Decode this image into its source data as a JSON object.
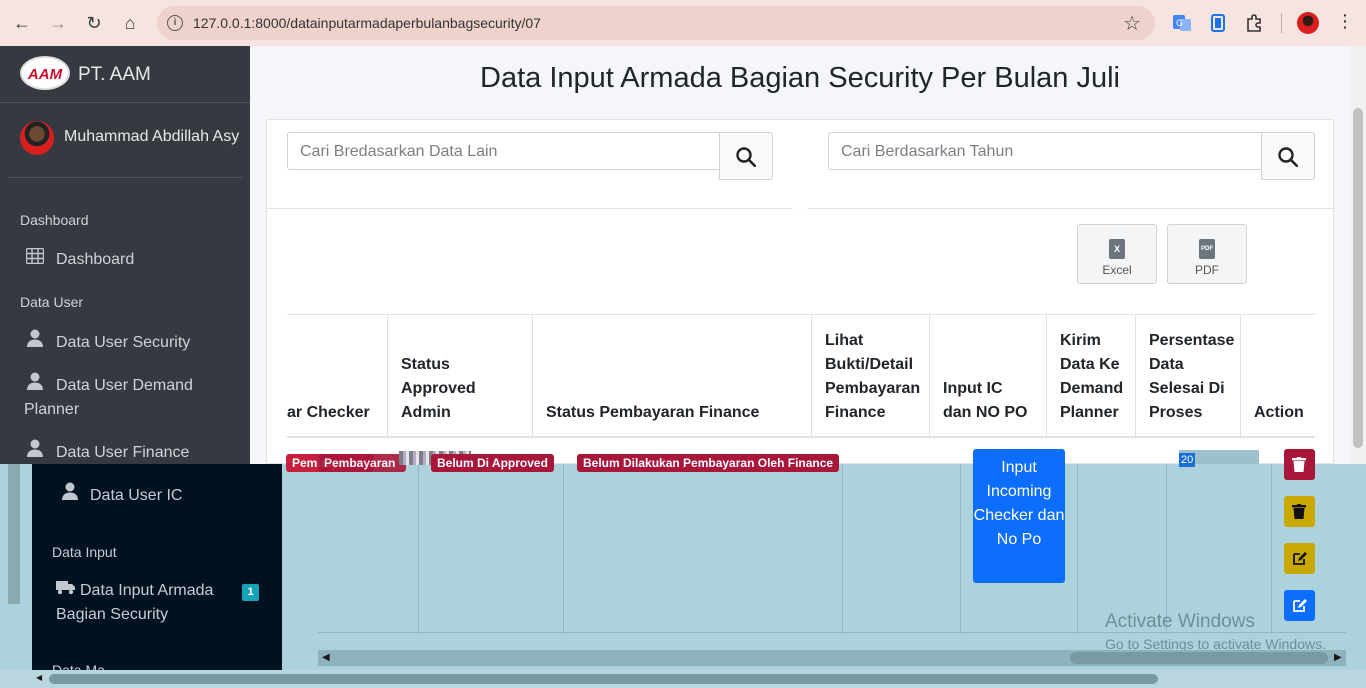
{
  "browser": {
    "url": "127.0.0.1:8000/datainputarmadaperbulanbagsecurity/07"
  },
  "sidebar": {
    "brand_logo": "AAM",
    "brand_text": "PT. AAM",
    "user_name": "Muhammad Abdillah Asy",
    "sections": [
      {
        "header": "Dashboard"
      },
      {
        "header": "Data User"
      },
      {
        "header": "Data Input"
      },
      {
        "header": "Data Ma..."
      }
    ],
    "items": [
      {
        "label": "Dashboard",
        "icon": "table-icon"
      },
      {
        "label": "Data User Security",
        "icon": "user-icon"
      },
      {
        "label": "Data User Demand Planner",
        "icon": "user-icon"
      },
      {
        "label": "Data User Finance",
        "icon": "user-icon"
      },
      {
        "label": "Data User IC",
        "icon": "user-icon"
      },
      {
        "label": "Data Input Armada Bagian Security",
        "icon": "truck-icon",
        "badge": "1"
      }
    ]
  },
  "main": {
    "title": "Data Input Armada Bagian Security Per Bulan Juli",
    "search_other_placeholder": "Cari Bredasarkan Data Lain",
    "search_year_placeholder": "Cari Berdasarkan Tahun",
    "export_excel": "Excel",
    "export_pdf": "PDF",
    "export_excel_glyph": "X",
    "export_pdf_glyph": "PDF"
  },
  "table": {
    "columns": [
      "ar Checker",
      "Status Approved Admin",
      "Status Pembayaran Finance",
      "Lihat Bukti/Detail Pembayaran Finance",
      "Input IC dan NO PO",
      "Kirim Data Ke Demand Planner",
      "Persentase Data Selesai Di Proses",
      "Action"
    ],
    "row": {
      "checker_status": "Pembayaran",
      "admin_status": "Belum Di Approved",
      "finance_status": "Belum Dilakukan Pembayaran Oleh Finance",
      "input_ic_button": "Input Incoming Checker dan No Po",
      "progress": "20"
    }
  },
  "windows_watermark": {
    "title": "Activate Windows",
    "subtitle": "Go to Settings to activate Windows."
  },
  "colors": {
    "sidebar": "#343a40",
    "badge_danger": "#a8163a",
    "primary": "#0d6efd",
    "warning": "#c9a800",
    "glitch_bg": "#acd3dd"
  }
}
